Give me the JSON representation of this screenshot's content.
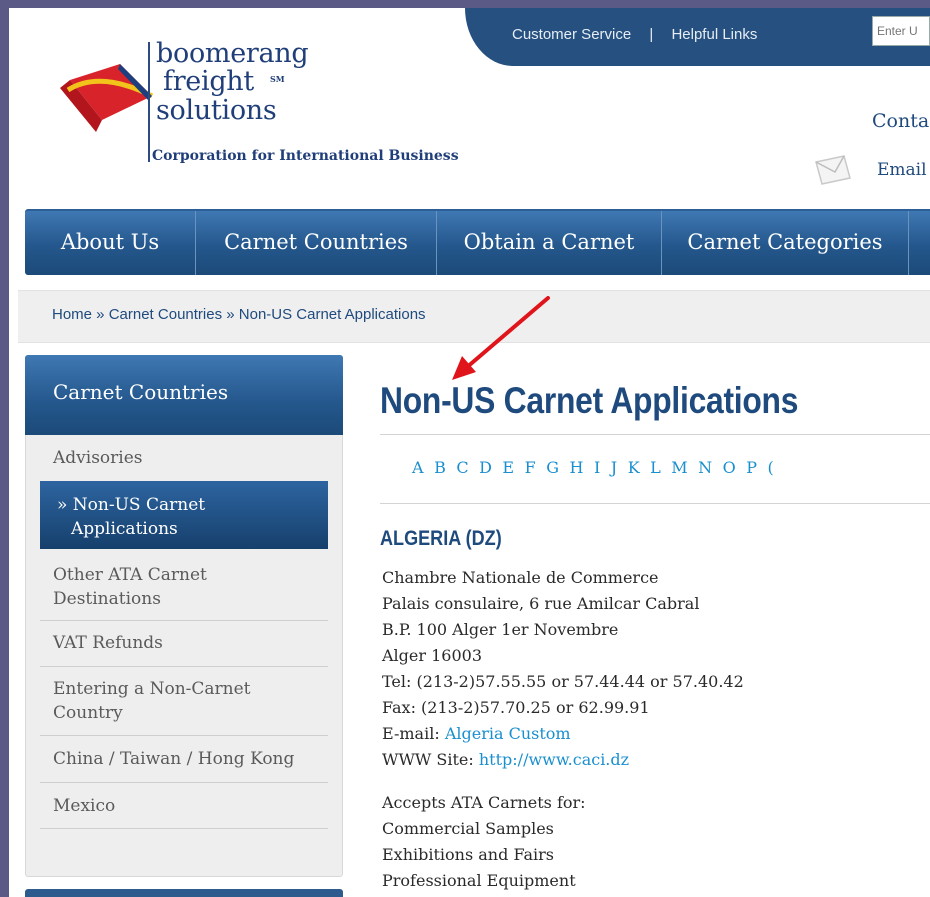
{
  "brand": {
    "word1": "boomerang",
    "word2": "freight",
    "sm": "SM",
    "word3": "solutions",
    "tagline": "Corporation for International Business",
    "logo_red": "#d8232a",
    "logo_yellow": "#f2c31b",
    "logo_blue": "#203e79"
  },
  "top": {
    "customer_service": "Customer Service",
    "separator": "|",
    "helpful_links": "Helpful Links",
    "search_placeholder": "Enter U"
  },
  "contact": {
    "title": "Conta",
    "email": "Email"
  },
  "nav": {
    "about": "About Us",
    "countries": "Carnet Countries",
    "obtain": "Obtain a Carnet",
    "categories": "Carnet Categories"
  },
  "breadcrumb": {
    "home": "Home",
    "sep": " » ",
    "countries": "Carnet Countries",
    "current": "Non-US Carnet Applications"
  },
  "sidebar": {
    "title": "Carnet Countries",
    "items": [
      {
        "label": "Advisories"
      },
      {
        "label": "» Non-US Carnet",
        "label2": "Applications"
      },
      {
        "label": "Other ATA Carnet",
        "label2": "Destinations"
      },
      {
        "label": "VAT Refunds"
      },
      {
        "label": "Entering a Non-Carnet",
        "label2": "Country"
      },
      {
        "label": "China / Taiwan / Hong Kong"
      },
      {
        "label": "Mexico"
      }
    ]
  },
  "main": {
    "title": "Non-US Carnet Applications",
    "alphabet": [
      "A",
      "B",
      "C",
      "D",
      "E",
      "F",
      "G",
      "H",
      "I",
      "J",
      "K",
      "L",
      "M",
      "N",
      "O",
      "P",
      "("
    ],
    "country": "ALGERIA (DZ)",
    "address": [
      "Chambre Nationale de Commerce",
      "Palais consulaire, 6 rue Amilcar Cabral",
      "B.P. 100 Alger 1er Novembre",
      "Alger 16003",
      "Tel: (213-2)57.55.55 or 57.44.44 or 57.40.42",
      "Fax: (213-2)57.70.25 or 62.99.91"
    ],
    "email_label": "E-mail: ",
    "email_link": "Algeria Custom",
    "www_label": "WWW Site: ",
    "www_link": "http://www.caci.dz",
    "accepts": [
      "Accepts ATA Carnets for:",
      "Commercial Samples",
      "Exhibitions and Fairs",
      "Professional Equipment"
    ]
  }
}
